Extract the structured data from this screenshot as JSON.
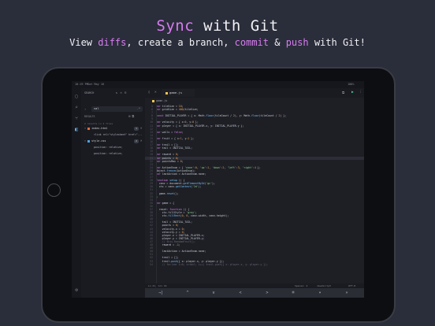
{
  "headline": {
    "accent": "Sync",
    "rest": " with Git"
  },
  "subline": {
    "p1": "View ",
    "a1": "diffs",
    "p2": ", create a branch, ",
    "a2": "commit",
    "p3": " & ",
    "a3": "push",
    "p4": " with Git!"
  },
  "colors": {
    "accent": "#d77cf0",
    "background": "#2a2d3a"
  },
  "status_bar": {
    "time": "10:19 PM",
    "date": "Sat May 16",
    "battery": "100%"
  },
  "sidebar": {
    "title": "SEARCH",
    "search_value": "val",
    "results_label": "RESULTS",
    "results_summary": "2 results in 2 files",
    "files": [
      {
        "name": "index.html",
        "count": "1",
        "match": "<link rel=\"stylesheet\" href=\"..."
      },
      {
        "name": "style.css",
        "count": "2",
        "matches": [
          "position: relative;",
          "position: relative;"
        ]
      }
    ]
  },
  "editor": {
    "tab_name": "game.js",
    "breadcrumb": "game.js",
    "lines": [
      [
        "5",
        "var tileSize = 10;"
      ],
      [
        "6",
        "var gridSize = 400/tileSize;"
      ],
      [
        "7",
        ""
      ],
      [
        "8",
        "const INITIAL_PLAYER = { x: Math.floor(tileCount / 2), y: Math.floor(tileCount / 2) };"
      ],
      [
        "9",
        ""
      ],
      [
        "10",
        "var velocity = { x:0, y:0 };"
      ],
      [
        "11",
        "var player = { x: INITIAL_PLAYER.x, y: INITIAL_PLAYER.y };"
      ],
      [
        "12",
        ""
      ],
      [
        "13",
        "var walls = false;"
      ],
      [
        "14",
        ""
      ],
      [
        "15",
        "var fruit = { x:1, y:1 };"
      ],
      [
        "16",
        ""
      ],
      [
        "17",
        "var trail = [];"
      ],
      [
        "18",
        "var tail = INITIAL_TAIL;"
      ],
      [
        "19",
        ""
      ],
      [
        "20",
        "var reward = 0;"
      ],
      [
        "21",
        "var points = 0;"
      ],
      [
        "22",
        "var pointsMax = 0;"
      ],
      [
        "23",
        ""
      ],
      [
        "24",
        "var ActionEnum = { 'none':0, 'up':1, 'down':2, 'left':3, 'right':4 };"
      ],
      [
        "25",
        "Object.freeze(ActionEnum);"
      ],
      [
        "26",
        "var lastAction = ActionEnum.none;"
      ],
      [
        "27",
        ""
      ],
      [
        "28",
        "function setup () {"
      ],
      [
        "29",
        "  canv = document.getElementById('gc');"
      ],
      [
        "30",
        "  ctx = canv.getContext('2d');"
      ],
      [
        "31",
        ""
      ],
      [
        "32",
        "  game.reset();"
      ],
      [
        "33",
        "}"
      ],
      [
        "34",
        ""
      ],
      [
        "35",
        "var game = {"
      ],
      [
        "36",
        ""
      ],
      [
        "37",
        "  reset: function () {"
      ],
      [
        "38",
        "    ctx.fillStyle = 'grey';"
      ],
      [
        "39",
        "    ctx.fillRect(0, 0, canv.width, canv.height);"
      ],
      [
        "40",
        ""
      ],
      [
        "41",
        "    tail = INITIAL_TAIL;"
      ],
      [
        "42",
        "    points = 0;"
      ],
      [
        "43",
        "    velocity.x = 0;"
      ],
      [
        "44",
        "    velocity.y = 0;"
      ],
      [
        "45",
        "    player.x = INITIAL_PLAYER.x;"
      ],
      [
        "46",
        "    player.y = INITIAL_PLAYER.y;"
      ],
      [
        "47",
        "    // this.RandomFruit();"
      ],
      [
        "48",
        "    reward = -1;"
      ],
      [
        "49",
        ""
      ],
      [
        "50",
        "    lastAction = ActionEnum.none;"
      ],
      [
        "51",
        ""
      ],
      [
        "52",
        "    trail = [];"
      ],
      [
        "53",
        "    trail.push({ x: player.x, y: player.y });"
      ],
      [
        "54",
        "    // for(var i=0; i<tail; i++) trail.push({ x: player.x, y: player.y });"
      ]
    ],
    "highlight_line": "21",
    "status": {
      "position": "Ln 21, Col 16",
      "spaces": "Spaces: 2",
      "language": "JavaScript",
      "encoding": "UTF-8"
    }
  },
  "keyboard_bar": [
    "→|",
    "^",
    "v",
    "<",
    ">",
    "⌘",
    "▾",
    "»"
  ]
}
